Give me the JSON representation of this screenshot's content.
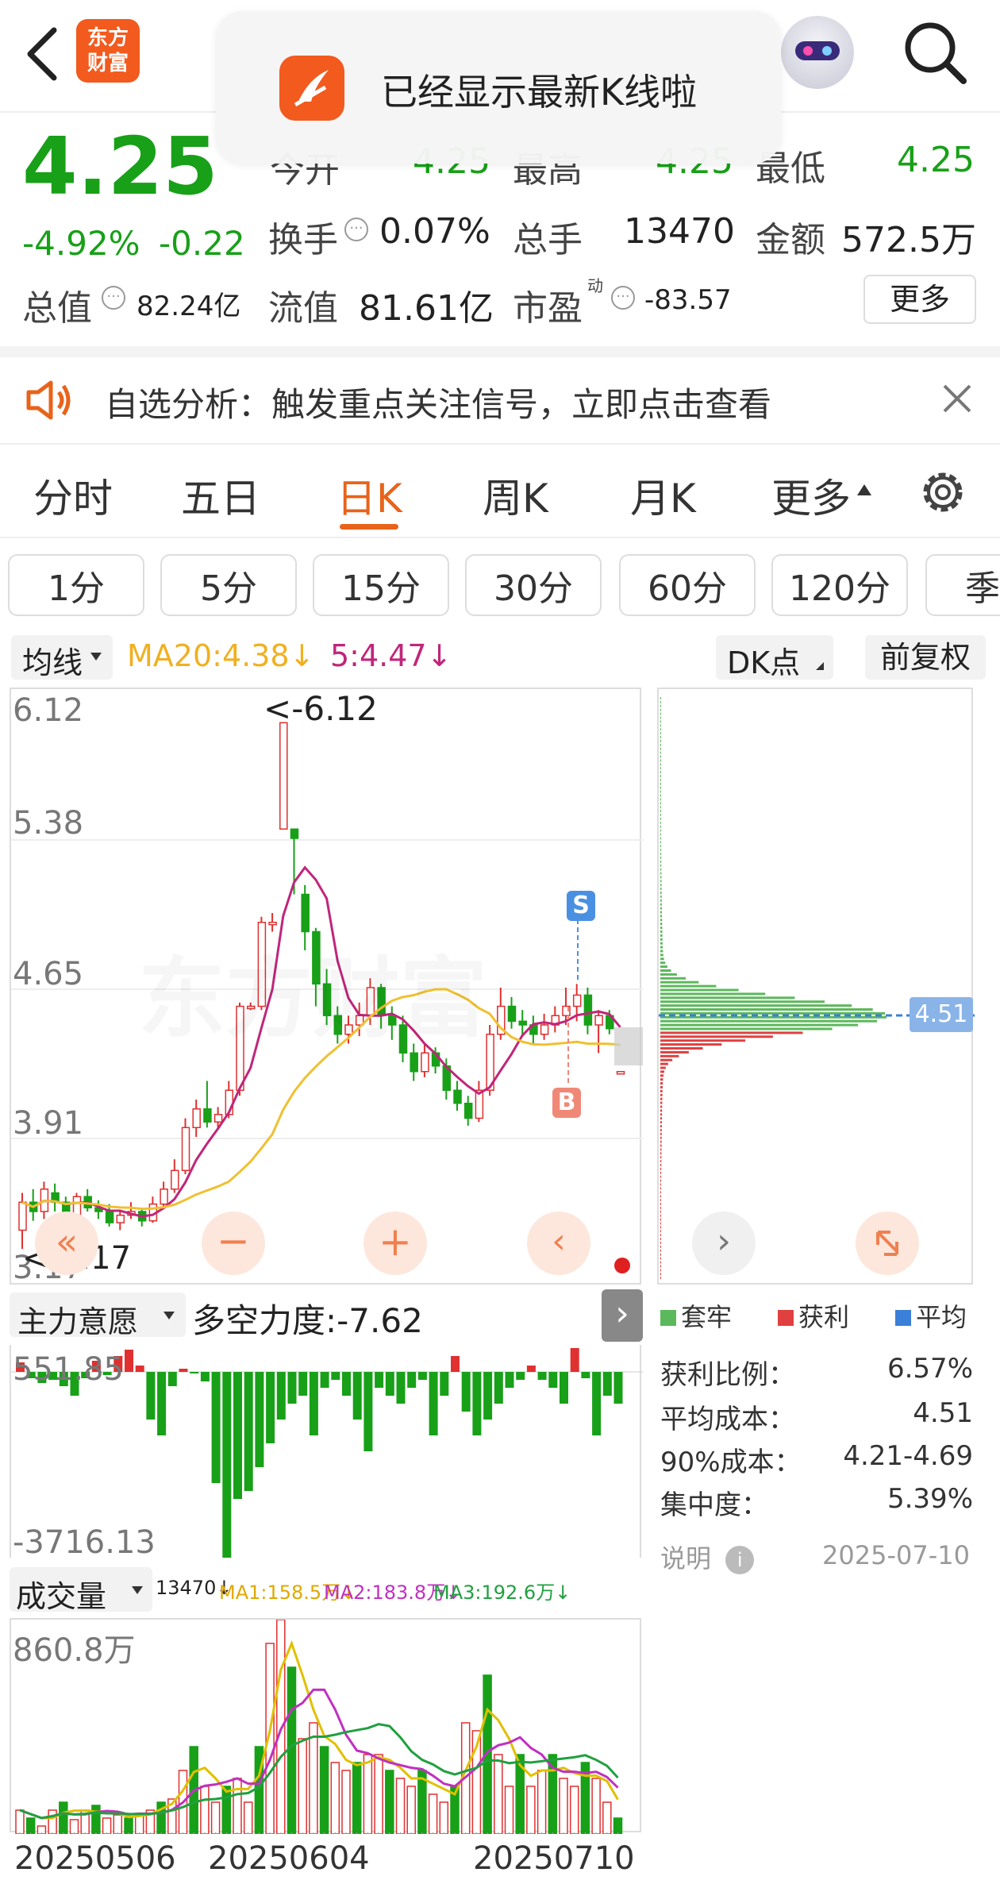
{
  "nav": {
    "logo_line1": "东方",
    "logo_line2": "财富"
  },
  "toast": {
    "text": "已经显示最新K线啦"
  },
  "quote": {
    "price": "4.25",
    "change_pct": "-4.92%",
    "change": "-0.22",
    "open_label": "今开",
    "open_value": "4.25",
    "high_label": "最高",
    "high_value": "4.25",
    "low_label": "最低",
    "low_value": "4.25",
    "turnover_label": "换手",
    "turnover_value": "0.07%",
    "volume_label": "总手",
    "volume_value": "13470",
    "amount_label": "金额",
    "amount_value": "572.5万",
    "mktcap_label": "总值",
    "mktcap_value": "82.24亿",
    "float_label": "流值",
    "float_value": "81.61亿",
    "pe_label": "市盈",
    "pe_sup": "动",
    "pe_value": "-83.57",
    "more_label": "更多"
  },
  "banner": {
    "text": "自选分析：触发重点关注信号，立即点击查看"
  },
  "tabs": {
    "t1": "分时",
    "t2": "五日",
    "t3": "日K",
    "t4": "周K",
    "t5": "月K",
    "t6": "更多"
  },
  "periods": {
    "p1": "1分",
    "p2": "5分",
    "p3": "15分",
    "p4": "30分",
    "p5": "60分",
    "p6": "120分",
    "p7": "季"
  },
  "indicators": {
    "ma_selector": "均线",
    "ma20": "MA20:4.38",
    "ma5": "5:4.47",
    "dk_label": "DK点",
    "adjust_label": "前复权"
  },
  "price_axis": {
    "a1": "6.12",
    "a2": "5.38",
    "a3": "4.65",
    "a4": "3.91",
    "a5": "3.17"
  },
  "price_annot": {
    "high": "<-6.12",
    "low": "<-3.17",
    "sell": "S",
    "buy": "B"
  },
  "chip_dist": {
    "avg_tag": "4.51",
    "legend_trapped": "套牢",
    "legend_profit": "获利",
    "legend_avg": "平均",
    "profit_ratio_label": "获利比例：",
    "profit_ratio": "6.57%",
    "avg_cost_label": "平均成本：",
    "avg_cost": "4.51",
    "cost90_label": "90%成本：",
    "cost90": "4.21-4.69",
    "concentration_label": "集中度：",
    "concentration": "5.39%",
    "note_label": "说明",
    "date": "2025-07-10"
  },
  "force": {
    "selector": "主力意愿",
    "value_text": "多空力度:-7.62",
    "top": "551.85",
    "bottom": "-3716.13"
  },
  "volume": {
    "selector": "成交量",
    "vol": "13470↓",
    "ma1": "MA1:158.5万↓",
    "ma2": "MA2:183.8万↓",
    "ma3": "MA3:192.6万↓",
    "axis_top": "860.8万"
  },
  "dates": {
    "d1": "20250506",
    "d2": "20250604",
    "d3": "20250710"
  },
  "colors": {
    "up": "#e03030",
    "down": "#18a018",
    "ma5": "#c0267a",
    "ma20": "#f0c030",
    "accent": "#e8631a",
    "avg": "#4a90e2"
  }
}
